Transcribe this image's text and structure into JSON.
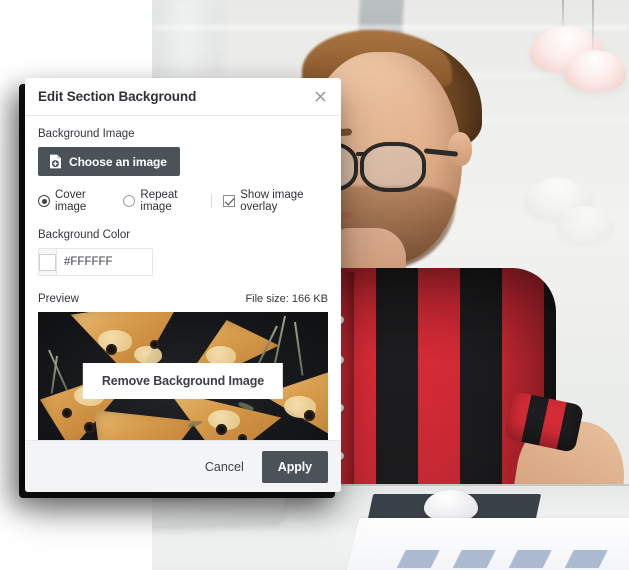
{
  "dialog": {
    "title": "Edit Section Background",
    "close_icon": "close-icon",
    "background_image": {
      "label": "Background Image",
      "choose_button": "Choose an image",
      "choose_button_icon": "file-add-icon",
      "options": [
        {
          "label": "Cover image",
          "type": "radio",
          "selected": true
        },
        {
          "label": "Repeat image",
          "type": "radio",
          "selected": false
        }
      ],
      "overlay": {
        "label": "Show image overlay",
        "type": "checkbox",
        "checked": true
      }
    },
    "background_color": {
      "label": "Background Color",
      "swatch_color": "#FFFFFF",
      "value": "#FFFFFF",
      "placeholder": "#FFFFFF"
    },
    "preview": {
      "label": "Preview",
      "file_size": "File size: 166 KB",
      "remove_button": "Remove Background Image",
      "image_description": "pizza slices on dark slate"
    },
    "footer": {
      "cancel_label": "Cancel",
      "apply_label": "Apply"
    }
  },
  "background_photo": {
    "description": "Man with glasses in red and black plaid shirt standing at a desk"
  },
  "colors": {
    "button_dark": "#4B5258",
    "footer_bg": "#F3F4F5",
    "text_primary": "#33373B",
    "border": "#E3E5E7",
    "shirt_red": "#D42B36",
    "shirt_black": "#1D1D1F"
  }
}
